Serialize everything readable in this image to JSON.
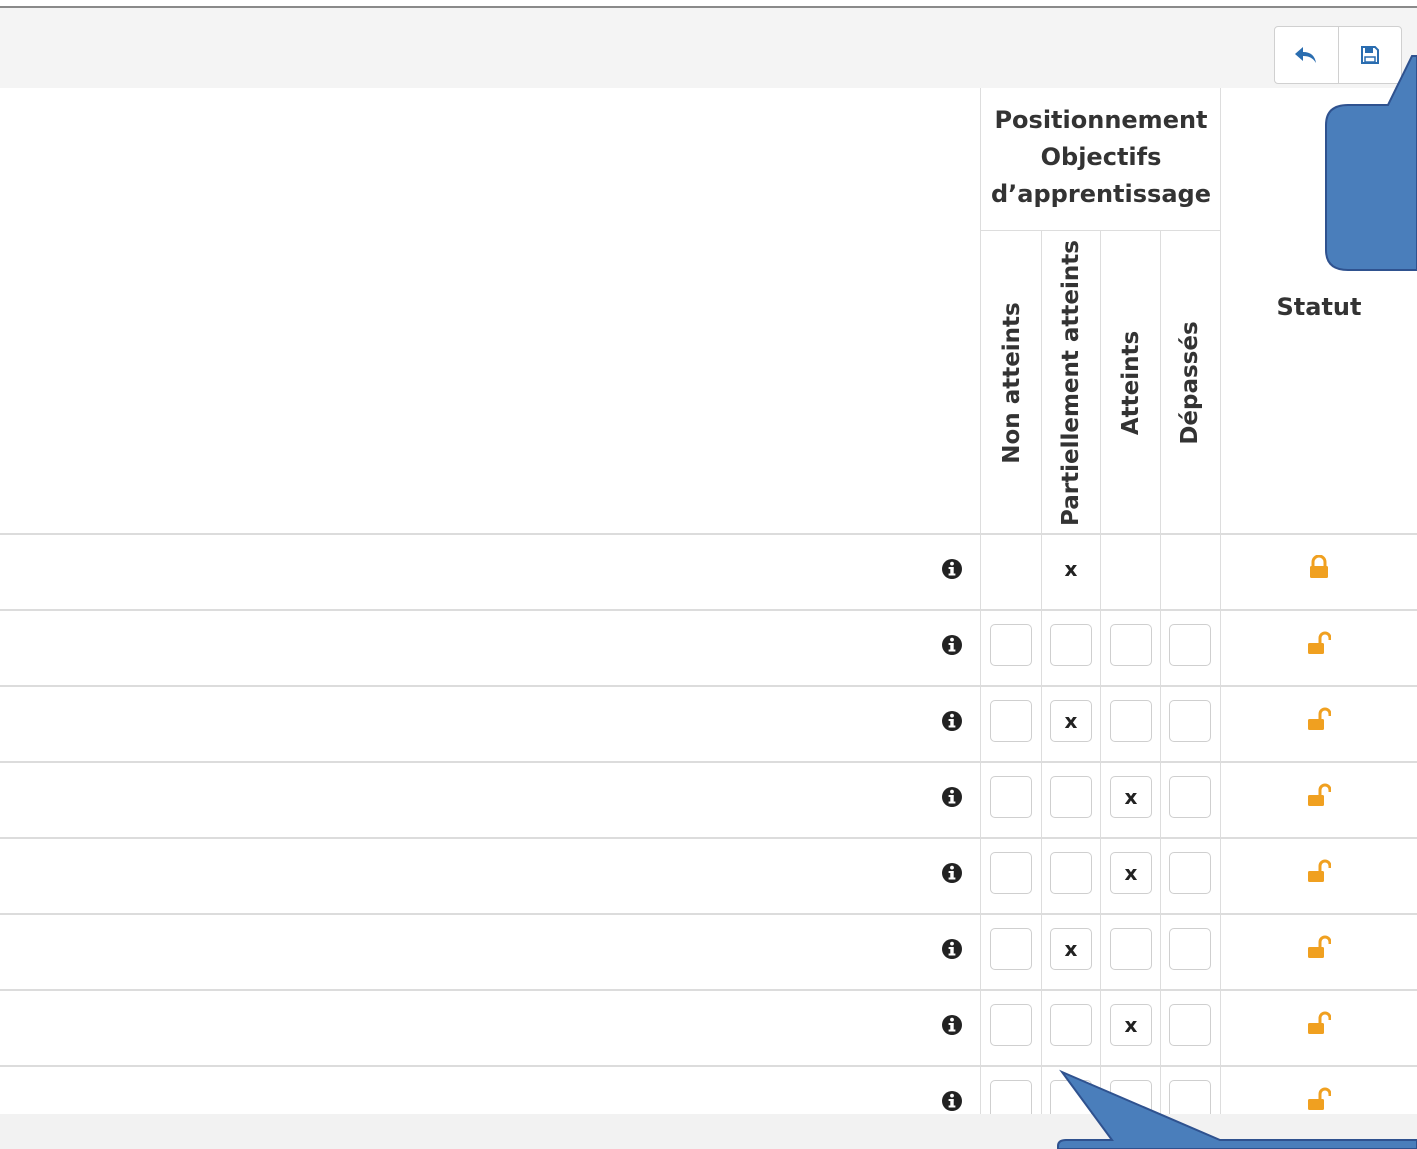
{
  "toolbar": {
    "back_icon": "reply-icon",
    "save_icon": "floppy-disk-icon"
  },
  "table": {
    "group_header": [
      "Positionnement",
      "Objectifs",
      "d’apprentissage"
    ],
    "columns": [
      "Non atteints",
      "Partiellement atteints",
      "Atteints",
      "Dépassés"
    ],
    "statut_header": "Statut",
    "mark": "x",
    "rows": [
      {
        "locked": true,
        "editable": false,
        "selected": 1
      },
      {
        "locked": false,
        "editable": true,
        "selected": -1
      },
      {
        "locked": false,
        "editable": true,
        "selected": 1
      },
      {
        "locked": false,
        "editable": true,
        "selected": 2
      },
      {
        "locked": false,
        "editable": true,
        "selected": 2
      },
      {
        "locked": false,
        "editable": true,
        "selected": 1
      },
      {
        "locked": false,
        "editable": true,
        "selected": 2
      },
      {
        "locked": false,
        "editable": true,
        "selected": -1
      }
    ]
  },
  "colors": {
    "lock": "#f0a020",
    "callout_fill": "#4a7ebb",
    "callout_stroke": "#2f528f",
    "toolbar_icon": "#2a6db0"
  }
}
